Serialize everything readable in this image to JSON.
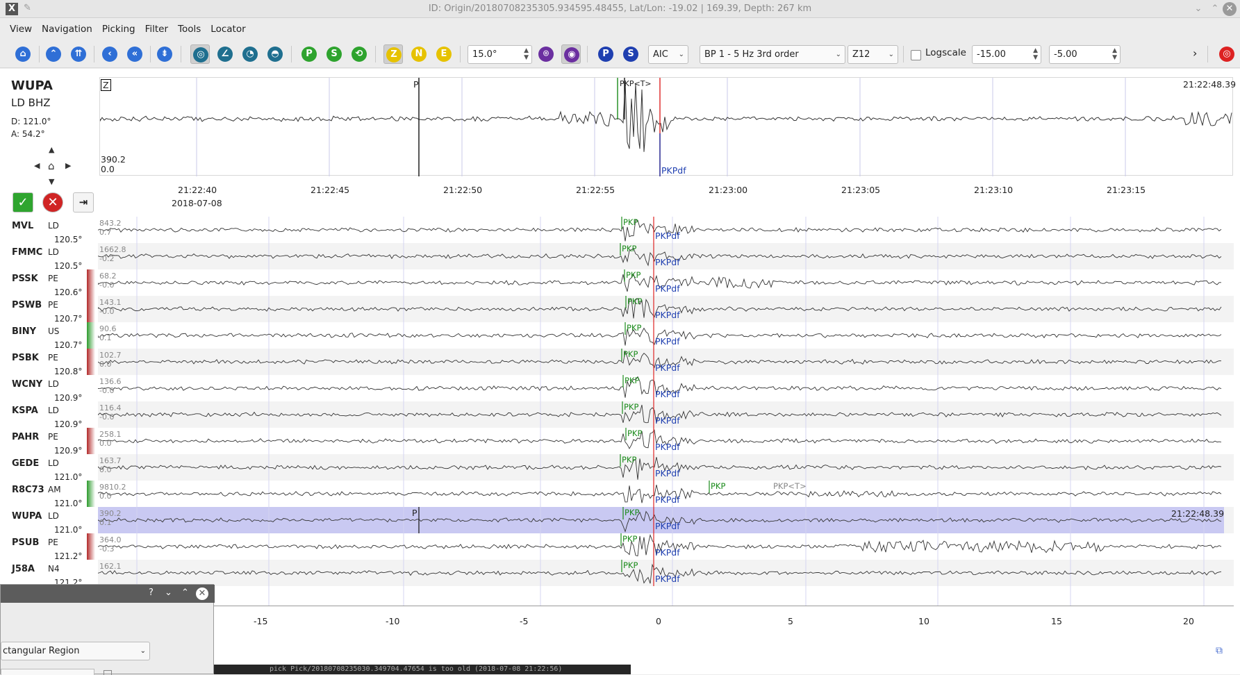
{
  "window": {
    "title": "ID: Origin/20180708235305.934595.48455, Lat/Lon: -19.02 | 169.39, Depth: 267 km",
    "app_icon": "X"
  },
  "menu": [
    "View",
    "Navigation",
    "Picking",
    "Filter",
    "Tools",
    "Locator"
  ],
  "toolbar": {
    "distance_value": "15.0°",
    "picker_method": "AIC",
    "filter": "BP 1 - 5 Hz  3rd order",
    "rotation": "Z12",
    "logscale_label": "Logscale",
    "min_value": "-15.00",
    "max_value": "-5.00",
    "more_arrow": "›",
    "comp_z": "Z",
    "comp_n": "N",
    "comp_e": "E",
    "phase_p": "P",
    "phase_s": "S"
  },
  "current_station": {
    "code": "WUPA",
    "net_channel": "LD  BHZ",
    "distance": "D:  121.0°",
    "azimuth": "A:  54.2°"
  },
  "zoom_trace": {
    "component": "Z",
    "amp_max": "390.2",
    "amp_min": "0.0",
    "time_label": "21:22:48.39",
    "pick_p": "P",
    "pick_pkp": "PKP<T>",
    "pick_pkpdf": "PKPdf",
    "ticks": [
      "21:22:40",
      "21:22:45",
      "21:22:50",
      "21:22:55",
      "21:23:00",
      "21:23:05",
      "21:23:10",
      "21:23:15"
    ],
    "date": "2018-07-08"
  },
  "rows": [
    {
      "name": "MVL",
      "net": "LD",
      "dist": "120.5°",
      "amp": "843.2",
      "off": "0.7",
      "status": ""
    },
    {
      "name": "FMMC",
      "net": "LD",
      "dist": "120.5°",
      "amp": "1662.8",
      "off": "-0.2",
      "status": ""
    },
    {
      "name": "PSSK",
      "net": "PE",
      "dist": "120.6°",
      "amp": "68.2",
      "off": "-0.0",
      "status": "#b22a2a"
    },
    {
      "name": "PSWB",
      "net": "PE",
      "dist": "120.7°",
      "amp": "143.1",
      "off": "-0.0",
      "status": "#b22a2a"
    },
    {
      "name": "BINY",
      "net": "US",
      "dist": "120.7°",
      "amp": "90.6",
      "off": "0.1",
      "status": "#2e9b2e"
    },
    {
      "name": "PSBK",
      "net": "PE",
      "dist": "120.8°",
      "amp": "102.7",
      "off": "0.0",
      "status": "#b22a2a"
    },
    {
      "name": "WCNY",
      "net": "LD",
      "dist": "120.9°",
      "amp": "136.6",
      "off": "-0.0",
      "status": ""
    },
    {
      "name": "KSPA",
      "net": "LD",
      "dist": "120.9°",
      "amp": "116.4",
      "off": "-0.0",
      "status": ""
    },
    {
      "name": "PAHR",
      "net": "PE",
      "dist": "120.9°",
      "amp": "258.1",
      "off": "0.0",
      "status": "#b22a2a"
    },
    {
      "name": "GEDE",
      "net": "LD",
      "dist": "121.0°",
      "amp": "163.7",
      "off": "0.0",
      "status": ""
    },
    {
      "name": "R8C73",
      "net": "AM",
      "dist": "121.0°",
      "amp": "9810.2",
      "off": "0.0",
      "status": "#2e9b2e"
    },
    {
      "name": "WUPA",
      "net": "LD",
      "dist": "121.0°",
      "amp": "390.2",
      "off": "0.1",
      "status": ""
    },
    {
      "name": "PSUB",
      "net": "PE",
      "dist": "121.2°",
      "amp": "364.0",
      "off": "-0.3",
      "status": "#b22a2a"
    },
    {
      "name": "J58A",
      "net": "N4",
      "dist": "121.2°",
      "amp": "162.1",
      "off": "",
      "status": ""
    }
  ],
  "row_picks": {
    "pkp": "PKP",
    "pkpt": "PKP<T>",
    "pkpdf": "PKPdf",
    "p": "P"
  },
  "selected_time": "21:22:48.39",
  "relative_ticks": [
    "-15",
    "-10",
    "-5",
    "0",
    "5",
    "10",
    "15",
    "20"
  ],
  "float_panel": {
    "help": "?",
    "region": "ctangular Region"
  },
  "status_text": "pick  Pick/20180708235030.349704.47654  is too old (2018-07-08 21:22:56)"
}
